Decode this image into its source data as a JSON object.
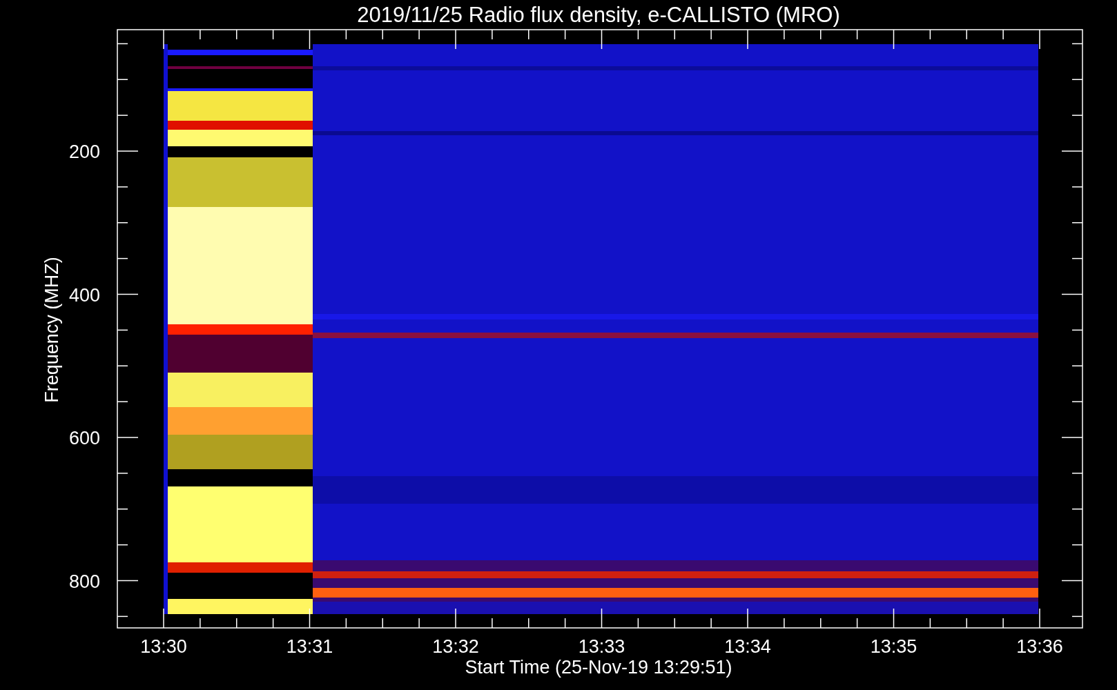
{
  "plot": {
    "title": "2019/11/25  Radio flux density, e-CALLISTO (MRO)",
    "ylabel": "Frequency (MHZ)",
    "yticks": [
      "200",
      "400",
      "600",
      "800"
    ],
    "xlabel": "Start Time (25-Nov-19 13:29:51)",
    "xticks": [
      "13:30",
      "13:31",
      "13:32",
      "13:33",
      "13:34",
      "13:35",
      "13:36"
    ]
  }
}
